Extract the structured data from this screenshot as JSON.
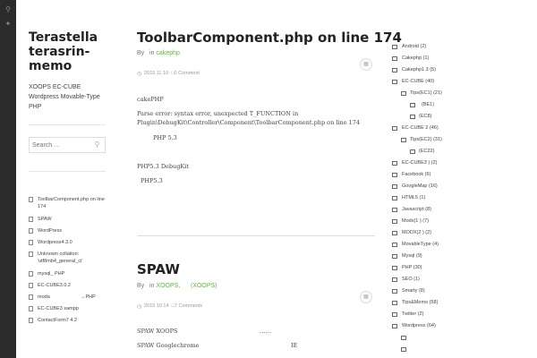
{
  "site": {
    "title": "Terastella  terasrin-memo",
    "description": "XOOPS  EC-CUBE  Wordpress  Movable-Type  PHP",
    "search_placeholder": "Search ..."
  },
  "recent_posts": [
    {
      "title": "ToolbarComponent.php on line 174",
      "extra": ""
    },
    {
      "title": "SPAW",
      "extra": ""
    },
    {
      "title": "WordPress",
      "extra": ""
    },
    {
      "title": "Wordpress4.3.0",
      "extra": ""
    },
    {
      "title": "Unknown collation: 'utf8mb4_general_ci'",
      "extra": ""
    },
    {
      "title": "mysql_     PHP",
      "extra": ""
    },
    {
      "title": "EC-CUBE3.0.2",
      "extra": ""
    },
    {
      "title": "moda",
      "extra": "→PHP"
    },
    {
      "title": "EC-CUBE3  xampp",
      "extra": ""
    },
    {
      "title": "ContactForm7  4.2",
      "extra": ""
    }
  ],
  "posts": [
    {
      "title": "ToolbarComponent.php on line 174",
      "meta_by": "By",
      "meta_in": "in",
      "category": "cakephp",
      "date": "2015  11  10",
      "comments": "0 Comment",
      "lines": [
        "cakePHP",
        "Parse error: syntax error, unexpected T_FUNCTION in",
        "Plugin\\DebugKit\\Controller\\Component\\ToolbarComponent.php on line 174",
        "PHP                5.3",
        "PHP5.3         DebugKit",
        "PHP5.3"
      ]
    },
    {
      "title": "SPAW",
      "meta_by": "By",
      "meta_in": "in",
      "category": "XOOPS,",
      "category2": "(XOOPS)",
      "date": "2015  10  14",
      "comments": "7 Comments",
      "lines": [
        "SPAW          XOOPS",
        "……",
        "SPAW          Googlechrome",
        "IE"
      ]
    }
  ],
  "categories": [
    {
      "label": "Android (2)"
    },
    {
      "label": "Cakephp (1)"
    },
    {
      "label": "Cakephp1.3 (5)"
    },
    {
      "label": "EC-CUBE                (40)"
    },
    {
      "label": "Tips(EC1) (21)"
    },
    {
      "label": "(BE1)"
    },
    {
      "label": "(EC8)"
    },
    {
      "label": "EC-CUBE  2       (46)"
    },
    {
      "label": "Tips(EC2) (31)"
    },
    {
      "label": "(EC22)"
    },
    {
      "label": "EC-CUBE3 ) (2)"
    },
    {
      "label": "Facebook (6)"
    },
    {
      "label": "GoogleMap (16)"
    },
    {
      "label": "HTML5 (1)"
    },
    {
      "label": "Javascript (8)"
    },
    {
      "label": "Modx(1 ) (7)"
    },
    {
      "label": "MODX(2 ) (2)"
    },
    {
      "label": "MovableType (4)"
    },
    {
      "label": "Mysql (9)"
    },
    {
      "label": "PHP (30)"
    },
    {
      "label": "SEO (1)"
    },
    {
      "label": "Smarty (8)"
    },
    {
      "label": "Tips&Memo (58)"
    },
    {
      "label": "Twitter (2)"
    },
    {
      "label": "Wordpress (64)"
    },
    {
      "label": ""
    },
    {
      "label": ""
    }
  ]
}
